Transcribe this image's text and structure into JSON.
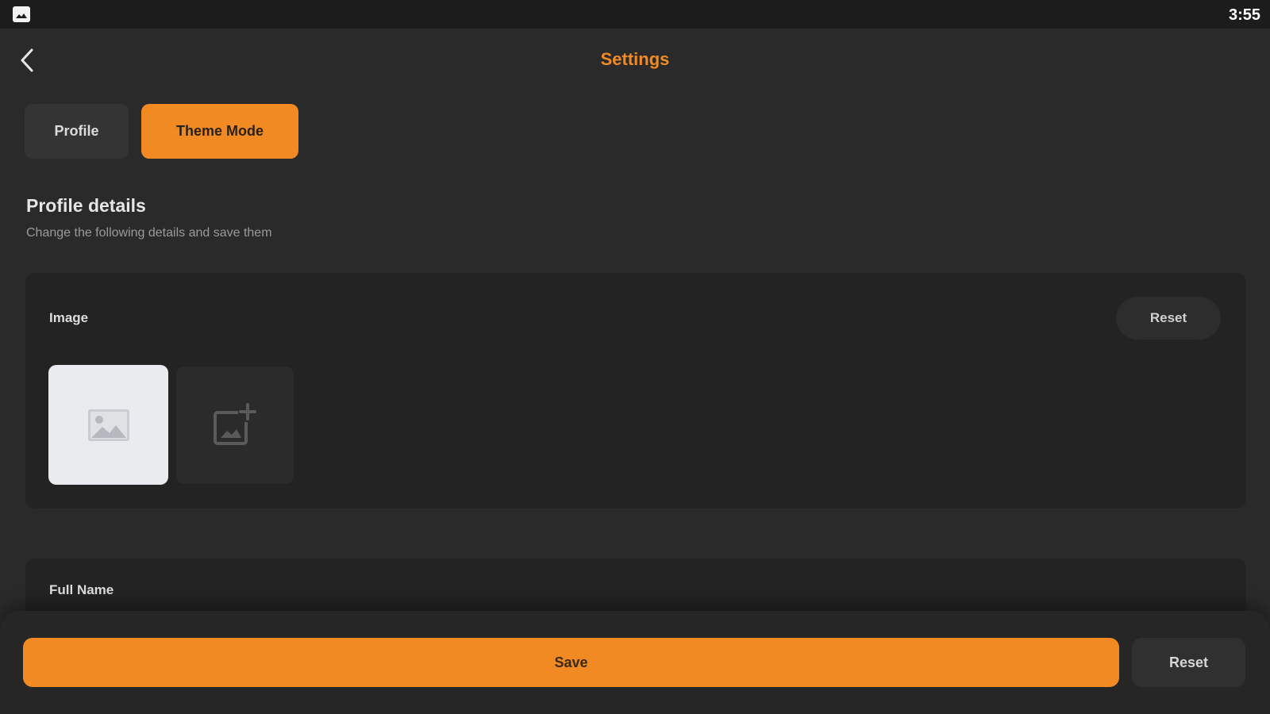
{
  "status_bar": {
    "time": "3:55",
    "left_icon": "gallery-icon"
  },
  "header": {
    "title": "Settings",
    "back_icon": "chevron-left-icon"
  },
  "tabs": [
    {
      "label": "Profile",
      "active": false
    },
    {
      "label": "Theme Mode",
      "active": true
    }
  ],
  "section": {
    "title": "Profile details",
    "subtitle": "Change the following details and save them"
  },
  "image_card": {
    "label": "Image",
    "reset_label": "Reset",
    "current_image_icon": "image-placeholder-icon",
    "add_image_icon": "add-image-icon"
  },
  "name_card": {
    "label": "Full Name"
  },
  "footer": {
    "save_label": "Save",
    "reset_label": "Reset"
  },
  "colors": {
    "accent": "#f28a24",
    "background": "#2a2a2a",
    "card": "#232323"
  }
}
